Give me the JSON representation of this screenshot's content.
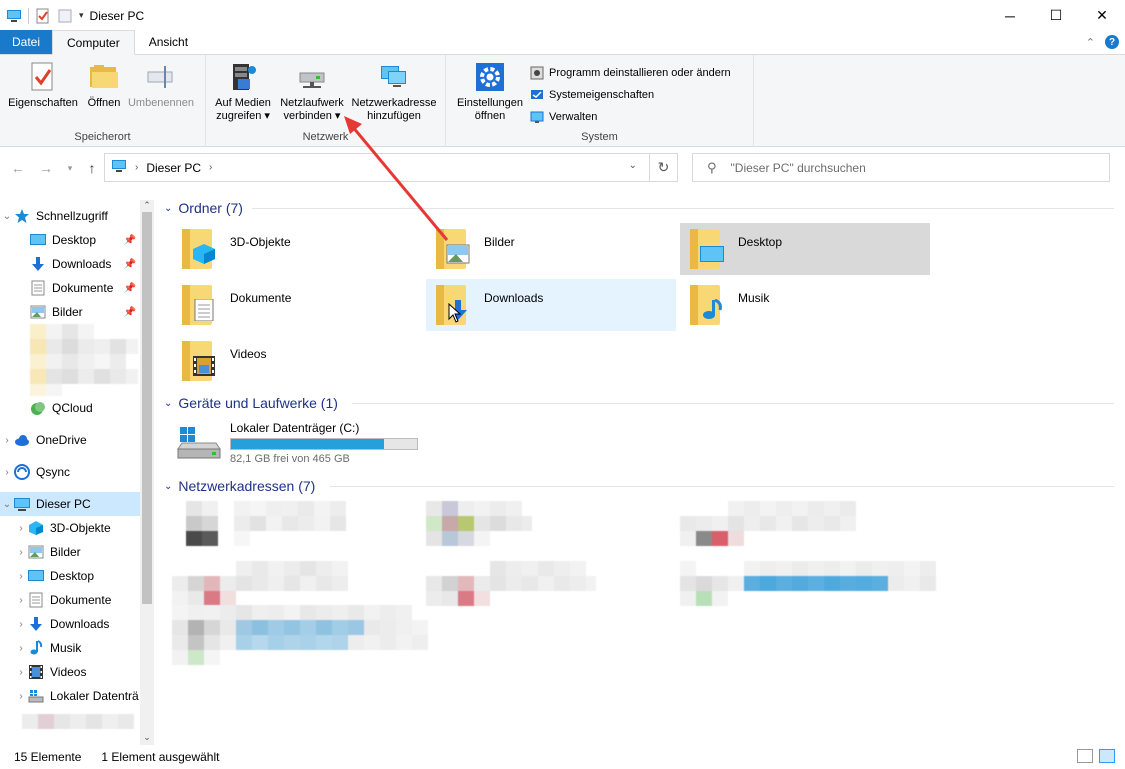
{
  "window": {
    "title": "Dieser PC",
    "minimize": "─",
    "maximize": "☐",
    "close": "✕"
  },
  "ribbon_tabs": [
    "Datei",
    "Computer",
    "Ansicht"
  ],
  "ribbon": {
    "groups": {
      "speicherort": "Speicherort",
      "netzwerk": "Netzwerk",
      "system": "System"
    },
    "buttons": {
      "eigenschaften": "Eigenschaften",
      "oeffnen": "Öffnen",
      "umbenennen": "Umbenennen",
      "medien_line1": "Auf Medien",
      "medien_line2": "zugreifen ▾",
      "netzlaufwerk_line1": "Netzlaufwerk",
      "netzlaufwerk_line2": "verbinden ▾",
      "netzadresse_line1": "Netzwerkadresse",
      "netzadresse_line2": "hinzufügen",
      "einstellungen_line1": "Einstellungen",
      "einstellungen_line2": "öffnen"
    },
    "system_items": [
      "Programm deinstallieren oder ändern",
      "Systemeigenschaften",
      "Verwalten"
    ]
  },
  "address": {
    "path": "Dieser PC",
    "search_placeholder": "\"Dieser PC\" durchsuchen"
  },
  "nav": {
    "schnellzugriff": "Schnellzugriff",
    "quick_items": [
      "Desktop",
      "Downloads",
      "Dokumente",
      "Bilder"
    ],
    "qcloud": "QCloud",
    "onedrive": "OneDrive",
    "qsync": "Qsync",
    "dieser_pc": "Dieser PC",
    "pc_items": [
      "3D-Objekte",
      "Bilder",
      "Desktop",
      "Dokumente",
      "Downloads",
      "Musik",
      "Videos",
      "Lokaler Datenträ"
    ]
  },
  "sections": {
    "ordner": "Ordner (7)",
    "geraete": "Geräte und Laufwerke (1)",
    "netzwerk": "Netzwerkadressen (7)"
  },
  "folders": [
    "3D-Objekte",
    "Bilder",
    "Desktop",
    "Dokumente",
    "Downloads",
    "Musik",
    "Videos"
  ],
  "drive": {
    "name": "Lokaler Datenträger (C:)",
    "free_text": "82,1 GB frei von 465 GB",
    "used_fraction": 0.823
  },
  "status": {
    "count": "15 Elemente",
    "selected": "1 Element ausgewählt"
  },
  "colors": {
    "accent": "#1979ca",
    "selection": "#cce8ff",
    "folder": "#f8d775",
    "section_header": "#1e3287",
    "annotation_arrow": "#e53935"
  }
}
